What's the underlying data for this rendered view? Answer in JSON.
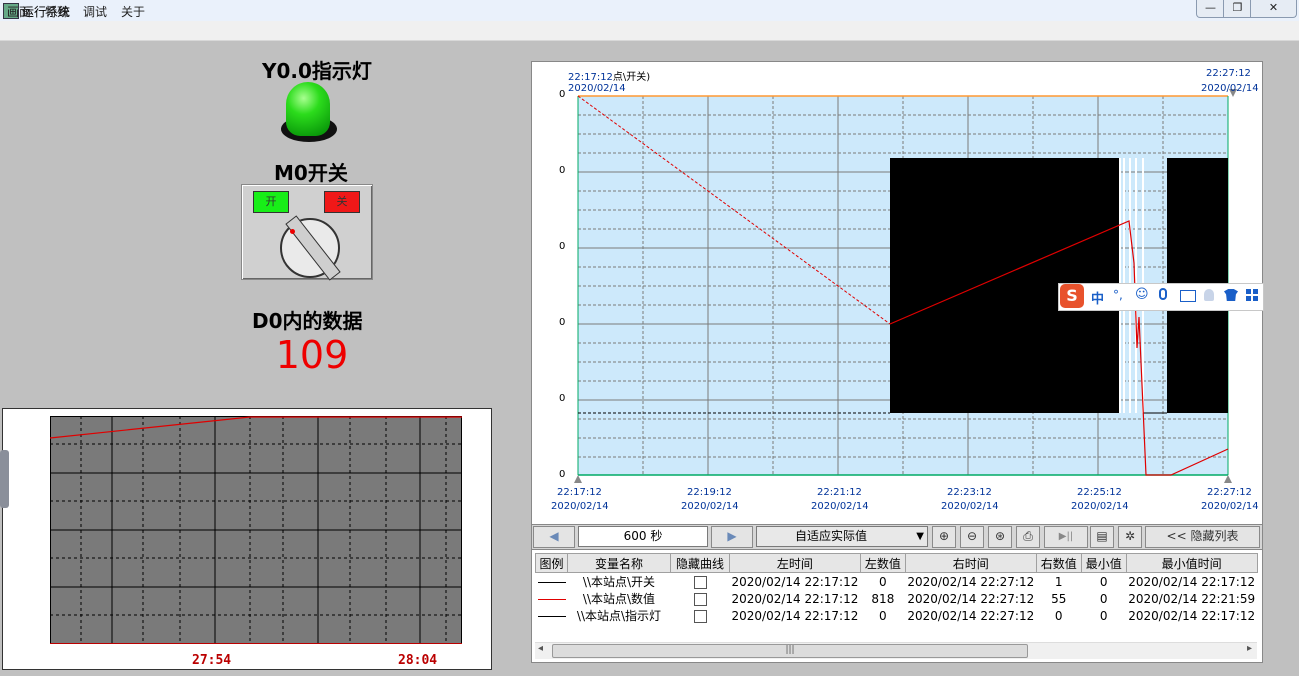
{
  "window": {
    "title": "运行系统",
    "min": "—",
    "max": "❐",
    "close": "✕"
  },
  "menu": [
    "画面",
    "特殊",
    "调试",
    "关于"
  ],
  "indicator": {
    "title": "Y0.0指示灯",
    "state_color": "#22dd22"
  },
  "switch": {
    "title": "M0开关",
    "on_label": "开",
    "off_label": "关"
  },
  "d0": {
    "title": "D0内的数据",
    "value": "109",
    "value_color": "#ee0000"
  },
  "mini_trend": {
    "time_left": "27:54",
    "time_right": "28:04"
  },
  "trend": {
    "series_label": "点\\开关)",
    "top_left_time": "22:17:12",
    "top_left_date": "2020/02/14",
    "top_right_time": "22:27:12",
    "top_right_date": "2020/02/14",
    "y_ticks": [
      "0",
      "0",
      "0",
      "0",
      "0",
      "0",
      "0"
    ],
    "x_ticks": [
      {
        "time": "22:17:12",
        "date": "2020/02/14"
      },
      {
        "time": "22:19:12",
        "date": "2020/02/14"
      },
      {
        "time": "22:21:12",
        "date": "2020/02/14"
      },
      {
        "time": "22:23:12",
        "date": "2020/02/14"
      },
      {
        "time": "22:25:12",
        "date": "2020/02/14"
      },
      {
        "time": "22:27:12",
        "date": "2020/02/14"
      }
    ],
    "colors": {
      "plot_bg": "#cde9fb",
      "grid": "#7a7a7a",
      "red": "#e00000"
    }
  },
  "ime": {
    "logo": "S",
    "mode": "中",
    "punct": "°,"
  },
  "controls": {
    "prev": "◀",
    "period": "600  秒",
    "next": "▶",
    "fit": "自适应实际值",
    "fit_arrow": "▼",
    "zoom_in": "⊕",
    "zoom_out": "⊖",
    "zoom_fit": "⊛",
    "print": "⎙",
    "play": "▶||",
    "export": "▤",
    "settings": "✲",
    "hide_list": "<< 隐藏列表"
  },
  "table": {
    "headers": [
      "图例",
      "变量名称",
      "隐藏曲线",
      "左时间",
      "左数值",
      "右时间",
      "右数值",
      "最小值",
      "最小值时间"
    ],
    "rows": [
      {
        "color": "#000000",
        "name": "\\\\本站点\\开关",
        "left_time": "2020/02/14 22:17:12",
        "left_value": "0",
        "right_time": "2020/02/14 22:27:12",
        "right_value": "1",
        "min": "0",
        "min_time": "2020/02/14 22:17:12"
      },
      {
        "color": "#e00000",
        "name": "\\\\本站点\\数值",
        "left_time": "2020/02/14 22:17:12",
        "left_value": "818",
        "right_time": "2020/02/14 22:27:12",
        "right_value": "55",
        "min": "0",
        "min_time": "2020/02/14 22:21:59"
      },
      {
        "color": "#000000",
        "name": "\\\\本站点\\指示灯",
        "left_time": "2020/02/14 22:17:12",
        "left_value": "0",
        "right_time": "2020/02/14 22:27:12",
        "right_value": "0",
        "min": "0",
        "min_time": "2020/02/14 22:17:12"
      }
    ]
  },
  "scrollbar": {
    "left": "◂",
    "thumb": "|||",
    "right": "▸"
  }
}
